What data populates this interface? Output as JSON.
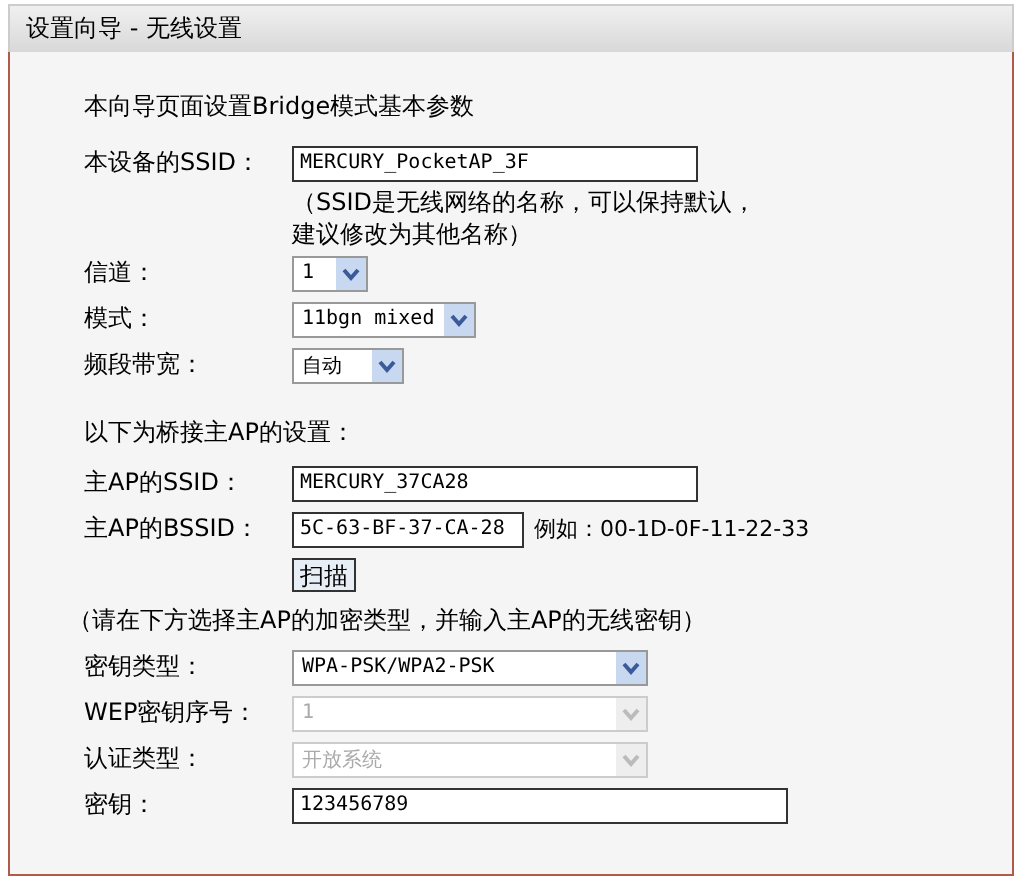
{
  "title": "设置向导 - 无线设置",
  "rows": [
    {
      "kind": "heading",
      "text": "本向导页面设置Bridge模式基本参数"
    },
    {
      "kind": "input",
      "label": "本设备的SSID：",
      "value": "MERCURY_PocketAP_3F"
    },
    {
      "kind": "hint",
      "text": "（SSID是无线网络的名称，可以保持默认，"
    },
    {
      "kind": "hint",
      "text": "建议修改为其他名称）"
    },
    {
      "kind": "select",
      "label": "信道：",
      "value": "1",
      "disabled": false
    },
    {
      "kind": "select",
      "label": "模式：",
      "value": "11bgn mixed",
      "disabled": false
    },
    {
      "kind": "select",
      "label": "频段带宽：",
      "value": "自动",
      "disabled": false
    },
    {
      "kind": "section",
      "text": "以下为桥接主AP的设置："
    },
    {
      "kind": "input",
      "label": "主AP的SSID：",
      "value": "MERCURY_37CA28"
    },
    {
      "kind": "input",
      "label": "主AP的BSSID：",
      "value": "5C-63-BF-37-CA-28",
      "example": "例如：00-1D-0F-11-22-33"
    },
    {
      "kind": "button",
      "text": "扫描"
    },
    {
      "kind": "note",
      "text": "（请在下方选择主AP的加密类型，并输入主AP的无线密钥）"
    },
    {
      "kind": "select",
      "label": "密钥类型：",
      "value": "WPA-PSK/WPA2-PSK",
      "disabled": false
    },
    {
      "kind": "select",
      "label": "WEP密钥序号：",
      "value": "1",
      "disabled": true
    },
    {
      "kind": "select",
      "label": "认证类型：",
      "value": "开放系统",
      "disabled": true
    },
    {
      "kind": "input",
      "label": "密钥：",
      "value": "123456789"
    }
  ]
}
